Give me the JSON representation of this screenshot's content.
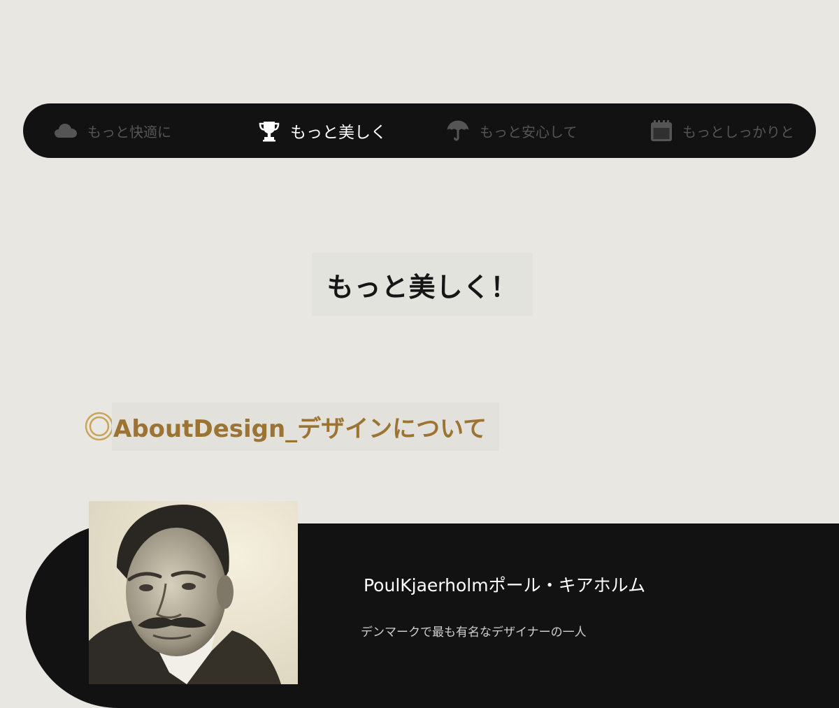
{
  "tabs": [
    {
      "label": "もっと快適に",
      "icon": "cloud-icon",
      "active": false
    },
    {
      "label": "もっと美しく",
      "icon": "trophy-icon",
      "active": true
    },
    {
      "label": "もっと安心して",
      "icon": "umbrella-icon",
      "active": false
    },
    {
      "label": "もっとしっかりと",
      "icon": "calendar-icon",
      "active": false
    }
  ],
  "main": {
    "heading": "もっと美しく！"
  },
  "section": {
    "title": "AboutDesign_デザインについて",
    "icon": "double-circle-icon"
  },
  "profile": {
    "name": "PoulKjaerholmポール・キアホルム",
    "description": "デンマークで最も有名なデザイナーの一人"
  },
  "colors": {
    "background": "#e8e7e2",
    "dark": "#121212",
    "accent_gold": "#9b7332",
    "inactive_tab": "#555555"
  }
}
